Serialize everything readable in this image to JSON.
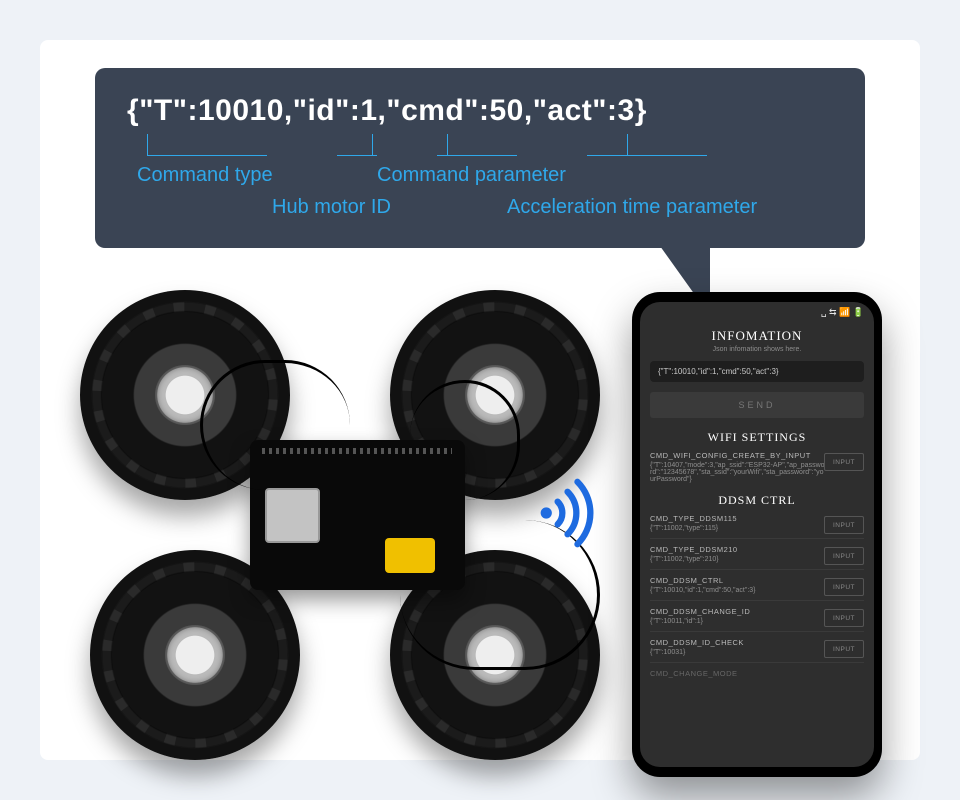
{
  "bubble": {
    "command_string": "{\"T\":10010,\"id\":1,\"cmd\":50,\"act\":3}",
    "parts": {
      "T_key": "\"T\"",
      "T_val": ":10010,",
      "id_key": "\"id\"",
      "id_val": ":1,",
      "cmd_key": "\"cmd\"",
      "cmd_val": ":50,",
      "act_key": "\"act\"",
      "act_val": ":3"
    },
    "labels": {
      "command_type": "Command type",
      "hub_motor_id": "Hub motor ID",
      "command_parameter": "Command parameter",
      "accel_time_parameter": "Acceleration time parameter"
    }
  },
  "phone": {
    "statusbar_icons": "␣ ⇆ 📶 🔋",
    "info_title": "INFOMATION",
    "info_sub": "Json infomation shows here.",
    "json_value": "{\"T\":10010,\"id\":1,\"cmd\":50,\"act\":3}",
    "send_label": "SEND",
    "wifi_title": "WIFI SETTINGS",
    "wifi_block": {
      "name": "CMD_WIFI_CONFIG_CREATE_BY_INPUT",
      "json": "{\"T\":10407,\"mode\":3,\"ap_ssid\":\"ESP32-AP\",\"ap_password\":\"12345678\",\"sta_ssid\":\"yourWifi\",\"sta_password\":\"yourPassword\"}"
    },
    "ddsm_title": "DDSM CTRL",
    "ddsm_blocks": [
      {
        "name": "CMD_TYPE_DDSM115",
        "json": "{\"T\":11002,\"type\":115}"
      },
      {
        "name": "CMD_TYPE_DDSM210",
        "json": "{\"T\":11002,\"type\":210}"
      },
      {
        "name": "CMD_DDSM_CTRL",
        "json": "{\"T\":10010,\"id\":1,\"cmd\":50,\"act\":3}"
      },
      {
        "name": "CMD_DDSM_CHANGE_ID",
        "json": "{\"T\":10011,\"id\":1}"
      },
      {
        "name": "CMD_DDSM_ID_CHECK",
        "json": "{\"T\":10031}"
      },
      {
        "name": "CMD_CHANGE_MODE",
        "json": ""
      }
    ],
    "input_label": "INPUT"
  }
}
